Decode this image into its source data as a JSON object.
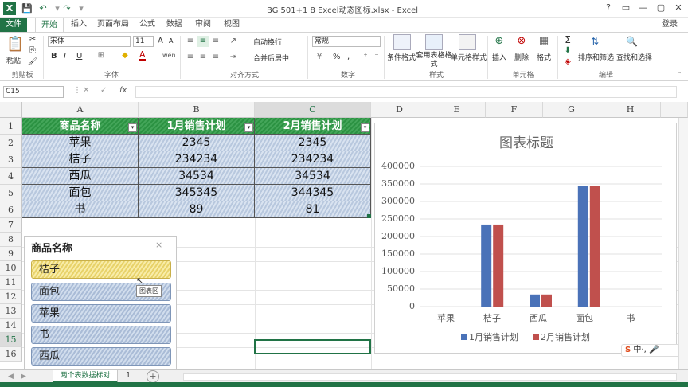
{
  "title_bar": {
    "doc_title": "BG 501+1 8 Excel动态图标.xlsx - Excel",
    "logo": "X",
    "qat_icons": [
      "save-icon",
      "undo-icon",
      "redo-icon",
      "customize-icon"
    ],
    "win_buttons": [
      "?",
      "▭",
      "—",
      "▢",
      "✕"
    ]
  },
  "tabs": [
    "文件",
    "开始",
    "插入",
    "页面布局",
    "公式",
    "数据",
    "审阅",
    "视图"
  ],
  "login": "登录",
  "ribbon": {
    "clipboard": {
      "paste": "粘贴",
      "label": "剪贴板"
    },
    "font": {
      "name": "宋体",
      "size": "11",
      "label": "字体",
      "bold": "B",
      "italic": "I",
      "underline": "U",
      "grow": "A",
      "shrink": "A",
      "color_a": "A",
      "wen": "wén"
    },
    "align": {
      "wrap": "自动换行",
      "merge": "合并后居中",
      "label": "对齐方式"
    },
    "number": {
      "format": "常规",
      "percent": "%",
      "comma": ",",
      "label": "数字"
    },
    "styles": {
      "cond": "条件格式",
      "table": "套用表格格式",
      "cell": "单元格样式",
      "label": "样式"
    },
    "cells": {
      "insert": "插入",
      "delete": "删除",
      "format": "格式",
      "label": "单元格"
    },
    "editing": {
      "sort": "排序和筛选",
      "find": "查找和选择",
      "label": "编辑"
    }
  },
  "formula_bar": {
    "name_box": "C15",
    "fx": "fx",
    "value": ""
  },
  "columns": [
    "A",
    "B",
    "C",
    "D",
    "E",
    "F",
    "G",
    "H"
  ],
  "rows": [
    "1",
    "2",
    "3",
    "4",
    "5",
    "6",
    "7",
    "8",
    "9",
    "10",
    "11",
    "12",
    "13",
    "14",
    "15",
    "16"
  ],
  "table": {
    "headers": [
      "商品名称",
      "1月销售计划",
      "2月销售计划"
    ],
    "rows": [
      [
        "苹果",
        "2345",
        "2345"
      ],
      [
        "桔子",
        "234234",
        "234234"
      ],
      [
        "西瓜",
        "34534",
        "34534"
      ],
      [
        "面包",
        "345345",
        "344345"
      ],
      [
        "书",
        "89",
        "81"
      ]
    ]
  },
  "slicer": {
    "title": "商品名称",
    "items": [
      "桔子",
      "面包",
      "苹果",
      "书",
      "西瓜"
    ],
    "selected": "桔子",
    "tooltip": "图表区"
  },
  "chart_data": {
    "type": "bar",
    "title": "图表标题",
    "categories": [
      "苹果",
      "桔子",
      "西瓜",
      "面包",
      "书"
    ],
    "series": [
      {
        "name": "1月销售计划",
        "values": [
          0,
          234234,
          34534,
          345345,
          0
        ],
        "color": "#4a72b8"
      },
      {
        "name": "2月销售计划",
        "values": [
          0,
          234234,
          34534,
          344345,
          0
        ],
        "color": "#c0504d"
      }
    ],
    "ylim": [
      0,
      400000
    ],
    "yticks": [
      "400000",
      "350000",
      "300000",
      "250000",
      "200000",
      "150000",
      "100000",
      "50000",
      "0"
    ],
    "grid": true,
    "legend": "bottom"
  },
  "sheet_tabs": {
    "active": "两个表数据标对",
    "second": "1",
    "add": "+"
  },
  "ime": {
    "label": "S中·,"
  }
}
